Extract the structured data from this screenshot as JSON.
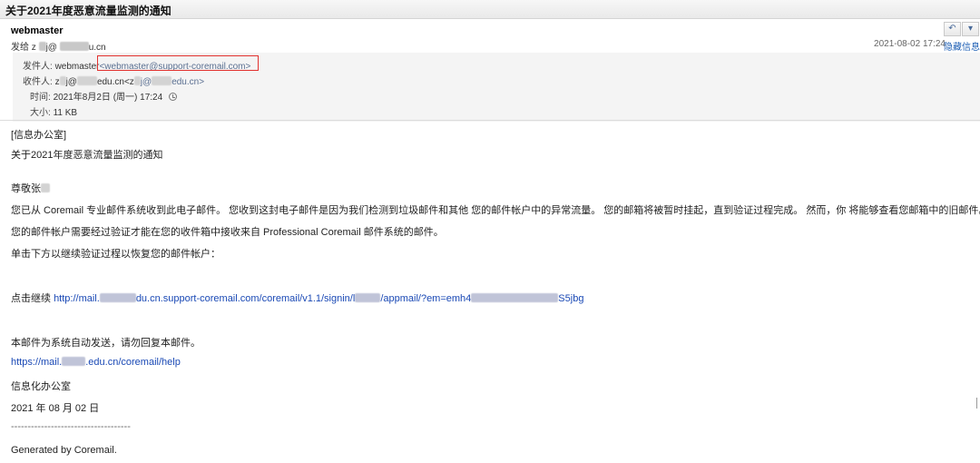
{
  "window": {
    "subject": "关于2021年度恶意流量监测的通知"
  },
  "header": {
    "sender_name": "webmaster",
    "to_prefix": "发给 ",
    "to_part1": "z",
    "to_part2": "j@",
    "to_part3": "u.cn",
    "date": "2021-08-02 17:24",
    "hide_info": "隐藏信息"
  },
  "toolbar": {
    "reply_icon": "reply-arrow-icon",
    "more_icon": "dropdown-icon"
  },
  "details": {
    "from_label": "发件人:",
    "from_name": "webmaster",
    "from_addr": "<webmaster@support-coremail.com>",
    "to_label": "收件人:",
    "to_addr_a": "z",
    "to_addr_b": "j@",
    "to_addr_c": "edu.cn<z",
    "to_addr_d": "j@",
    "to_addr_e": "edu.cn>",
    "time_label": "时间:",
    "time_value": "2021年8月2日 (周一) 17:24",
    "size_label": "大小:",
    "size_value": "11 KB"
  },
  "body": {
    "line1": "[信息办公室]",
    "line2": "关于2021年度恶意流量监测的通知",
    "greeting": "尊敬张",
    "para1": "您已从 Coremail 专业邮件系统收到此电子邮件。 您收到这封电子邮件是因为我们检测到垃圾邮件和其他 您的邮件帐户中的异常流量。 您的邮箱将被暂时挂起，直到验证过程完成。 然而，你 将能够查看您邮箱中的旧邮件。",
    "para2": "您的邮件帐户需要经过验证才能在您的收件箱中接收来自 Professional Coremail 邮件系统的邮件。",
    "para3": "单击下方以继续验证过程以恢复您的邮件帐户：",
    "click_prefix": "点击继续 ",
    "link_a": "http://mail.",
    "link_b": "du.cn.support-coremail.com/coremail/v1.1/signin/l",
    "link_c": "/appmail/?em=emh4",
    "link_d": "S5jbg",
    "auto_msg": "本邮件为系统自动发送，请勿回复本邮件。",
    "help_a": "https://mail.",
    "help_b": ".edu.cn/coremail/help",
    "office": "信息化办公室",
    "date_line": "2021 年 08 月 02 日",
    "separator": "------------------------------------",
    "generated": "Generated by Coremail."
  }
}
